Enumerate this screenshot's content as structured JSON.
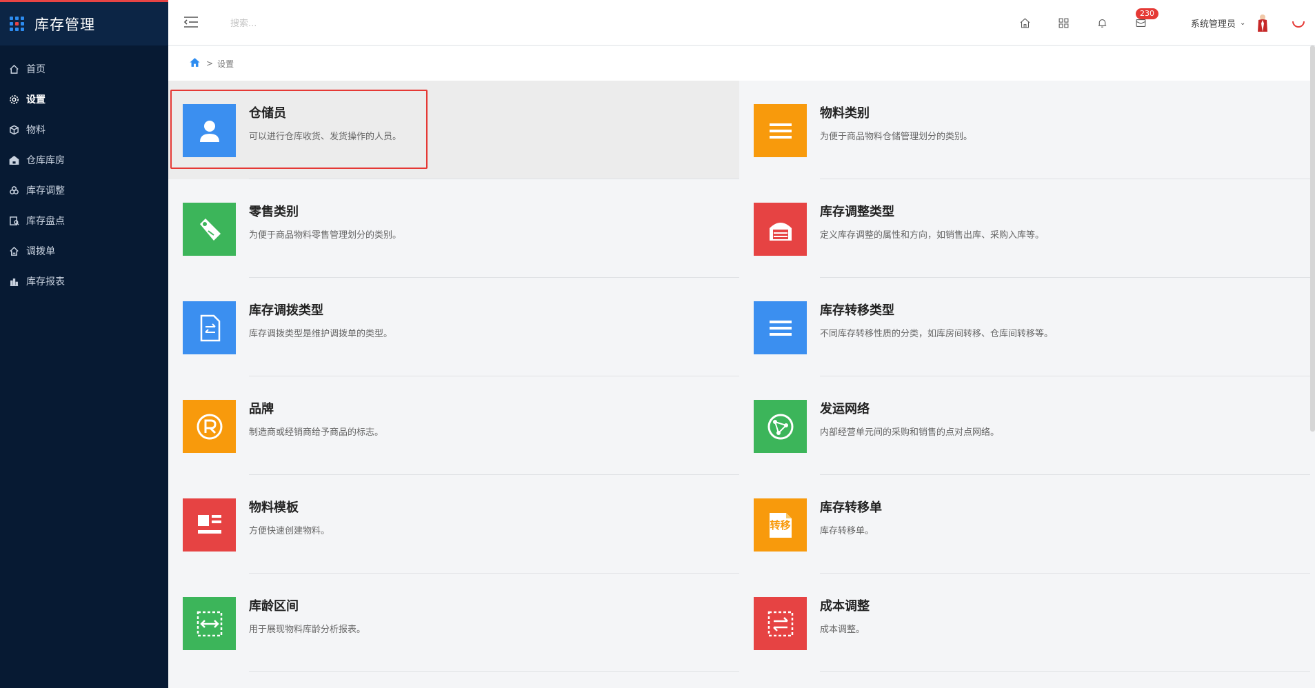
{
  "app": {
    "title": "库存管理",
    "dot_colors": [
      "#2d8cf0",
      "#2d8cf0",
      "#2d8cf0",
      "#2d8cf0",
      "#e84444",
      "#2d8cf0",
      "#2d8cf0",
      "#2d8cf0",
      "#2d8cf0"
    ]
  },
  "sidebar": {
    "items": [
      {
        "label": "首页",
        "icon": "home-icon",
        "active": false
      },
      {
        "label": "设置",
        "icon": "gear-icon",
        "active": true
      },
      {
        "label": "物料",
        "icon": "cube-icon",
        "active": false
      },
      {
        "label": "仓库库房",
        "icon": "warehouse-icon",
        "active": false
      },
      {
        "label": "库存调整",
        "icon": "adjust-icon",
        "active": false
      },
      {
        "label": "库存盘点",
        "icon": "inventory-check-icon",
        "active": false
      },
      {
        "label": "调拨单",
        "icon": "transfer-icon",
        "active": false
      },
      {
        "label": "库存报表",
        "icon": "bar-chart-icon",
        "active": false
      }
    ]
  },
  "header": {
    "search_placeholder": "搜索...",
    "notification_count": "230",
    "user_name": "系统管理员"
  },
  "breadcrumb": {
    "separator": ">",
    "current": "设置"
  },
  "cards": [
    {
      "title": "仓储员",
      "desc": "可以进行仓库收货、发货操作的人员。",
      "color": "#3b8ff0",
      "icon": "person-icon",
      "highlight": true
    },
    {
      "title": "物料类别",
      "desc": "为便于商品物料仓储管理划分的类别。",
      "color": "#f89a0c",
      "icon": "list-icon",
      "highlight": false
    },
    {
      "title": "零售类别",
      "desc": "为便于商品物料零售管理划分的类别。",
      "color": "#3cb55a",
      "icon": "tag-icon",
      "highlight": false
    },
    {
      "title": "库存调整类型",
      "desc": "定义库存调整的属性和方向，如销售出库、采购入库等。",
      "color": "#e64343",
      "icon": "garage-icon",
      "highlight": false
    },
    {
      "title": "库存调拨类型",
      "desc": "库存调拨类型是维护调拨单的类型。",
      "color": "#3b8ff0",
      "icon": "document-transfer-icon",
      "highlight": false
    },
    {
      "title": "库存转移类型",
      "desc": "不同库存转移性质的分类，如库房间转移、仓库间转移等。",
      "color": "#3b8ff0",
      "icon": "list-icon",
      "highlight": false
    },
    {
      "title": "品牌",
      "desc": "制造商或经销商给予商品的标志。",
      "color": "#f89a0c",
      "icon": "registered-icon",
      "highlight": false
    },
    {
      "title": "发运网络",
      "desc": "内部经营单元间的采购和销售的点对点网络。",
      "color": "#3cb55a",
      "icon": "network-globe-icon",
      "highlight": false
    },
    {
      "title": "物料模板",
      "desc": "方便快速创建物料。",
      "color": "#e64343",
      "icon": "template-icon",
      "highlight": false
    },
    {
      "title": "库存转移单",
      "desc": "库存转移单。",
      "color": "#f89a0c",
      "icon": "transfer-doc-icon",
      "icon_text": "转移",
      "highlight": false
    },
    {
      "title": "库龄区间",
      "desc": "用于展现物料库龄分析报表。",
      "color": "#3cb55a",
      "icon": "range-icon",
      "highlight": false
    },
    {
      "title": "成本调整",
      "desc": "成本调整。",
      "color": "#e64343",
      "icon": "cost-adjust-icon",
      "highlight": false
    }
  ]
}
